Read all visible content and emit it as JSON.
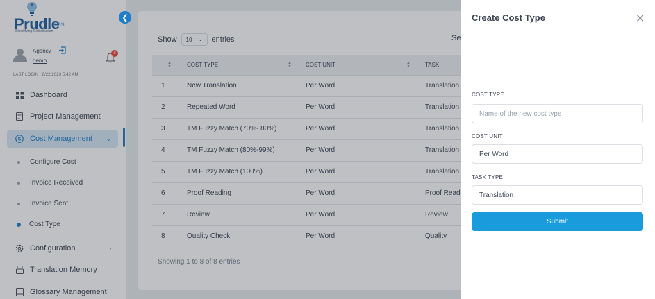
{
  "brand": {
    "name": "Prudle",
    "suffix": "Labs",
    "tagline": "Simplifying Globalisation"
  },
  "user": {
    "role": "Agency",
    "name": "demo",
    "notifications": "8",
    "last_login": "LAST LOGIN : 8/22/2023 5:42 AM"
  },
  "sidebar": {
    "items": [
      {
        "label": "Dashboard",
        "icon": "grid-icon"
      },
      {
        "label": "Project Management",
        "icon": "document-icon"
      },
      {
        "label": "Cost Management",
        "icon": "dollar-icon",
        "active": true
      },
      {
        "label": "Configuration",
        "icon": "gear-icon"
      },
      {
        "label": "Translation Memory",
        "icon": "stack-icon"
      },
      {
        "label": "Glossary Management",
        "icon": "book-icon"
      }
    ],
    "subitems": [
      {
        "label": "Configure Cost"
      },
      {
        "label": "Invoice Received"
      },
      {
        "label": "Invoice Sent"
      },
      {
        "label": "Cost Type",
        "active": true
      }
    ]
  },
  "table": {
    "show_label": "Show",
    "page_size": "10",
    "entries_label": "entries",
    "search_label": "Se",
    "headers": [
      "",
      "COST TYPE",
      "COST UNIT",
      "TASK"
    ],
    "rows": [
      [
        "1",
        "New Translation",
        "Per Word",
        "Translation"
      ],
      [
        "2",
        "Repeated Word",
        "Per Word",
        "Translation"
      ],
      [
        "3",
        "TM Fuzzy Match (70%- 80%)",
        "Per Word",
        "Translation"
      ],
      [
        "4",
        "TM Fuzzy Match (80%-99%)",
        "Per Word",
        "Translation"
      ],
      [
        "5",
        "TM Fuzzy Match (100%)",
        "Per Word",
        "Translation"
      ],
      [
        "6",
        "Proof Reading",
        "Per Word",
        "Proof Read"
      ],
      [
        "7",
        "Review",
        "Per Word",
        "Review"
      ],
      [
        "8",
        "Quality Check",
        "Per Word",
        "Quality"
      ]
    ],
    "info": "Showing 1 to 8 of 8 entries"
  },
  "drawer": {
    "title": "Create Cost Type",
    "cost_type_label": "COST TYPE",
    "cost_type_placeholder": "Name of the new cost type",
    "cost_unit_label": "COST UNIT",
    "cost_unit_value": "Per Word",
    "task_type_label": "TASK TYPE",
    "task_type_value": "Translation",
    "submit_label": "Submit"
  },
  "colors": {
    "accent": "#1a9bdc",
    "brand": "#1f5f9e",
    "badge": "#e8443a"
  }
}
